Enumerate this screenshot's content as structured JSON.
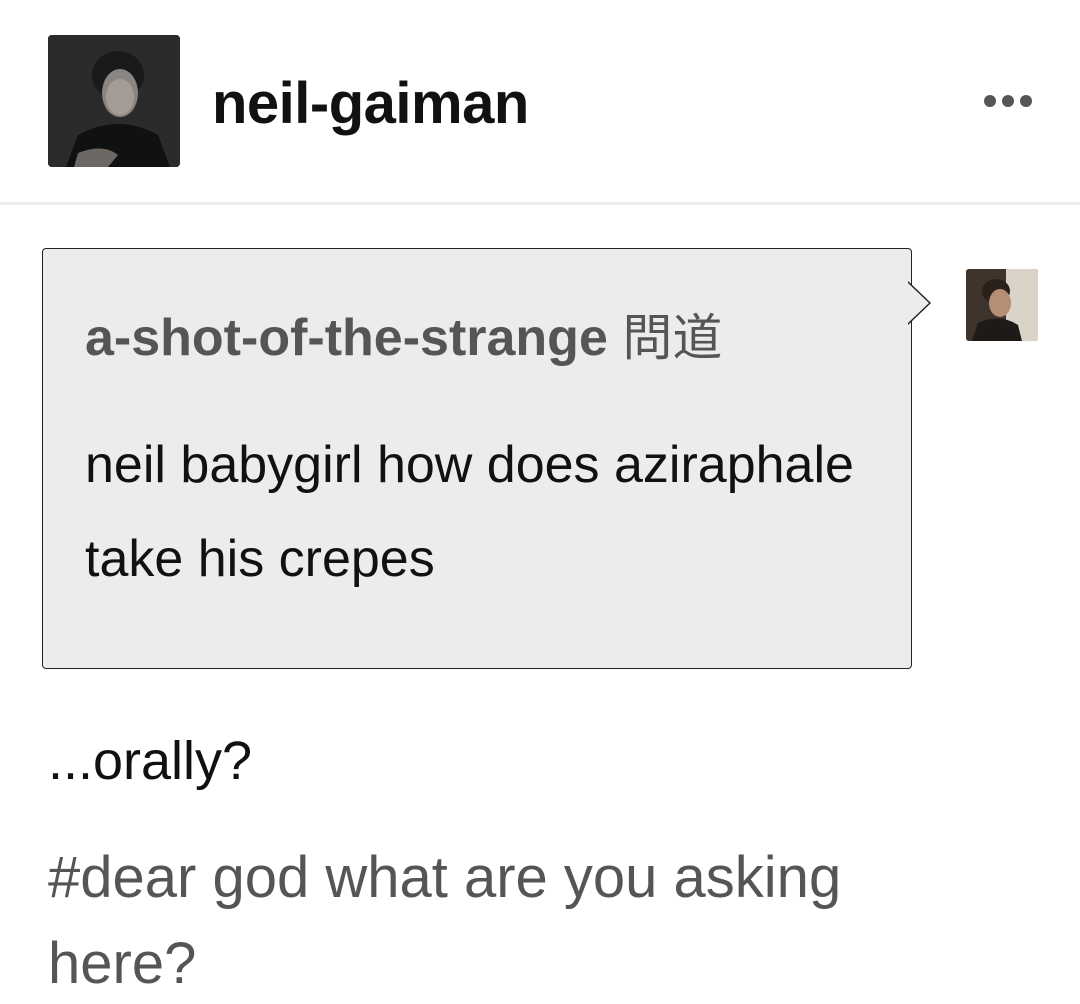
{
  "post": {
    "blog_name": "neil-gaiman",
    "ask": {
      "asker": "a-shot-of-the-strange",
      "asked_label": "問道",
      "question": "neil babygirl how does aziraphale take his crepes"
    },
    "answer": "...orally?",
    "tags": "#dear god what are you asking here?"
  },
  "icons": {
    "more": "more-horizontal-icon"
  }
}
